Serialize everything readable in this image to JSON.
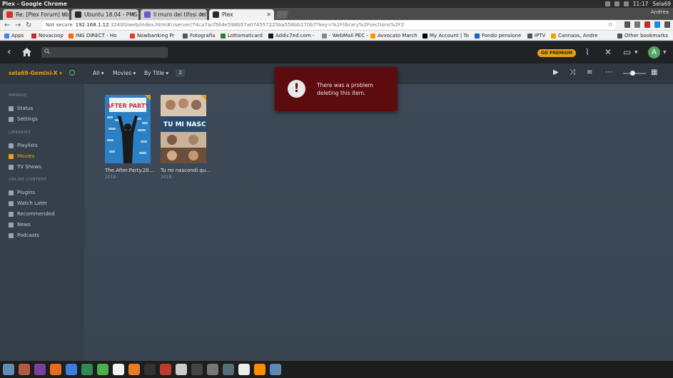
{
  "os": {
    "window_title": "Plex - Google Chrome",
    "time": "11:17",
    "user": "Sela69",
    "profile": "Andrea"
  },
  "tabs": [
    {
      "title": "Re: [Plex Forum] Ub",
      "color": "#d93025"
    },
    {
      "title": "Ubuntu 18.04 - PMS",
      "color": "#282828"
    },
    {
      "title": "Il muro dei tifosi del",
      "color": "#6a5acd"
    },
    {
      "title": "Plex",
      "color": "#282828"
    }
  ],
  "address": {
    "not_secure": "Not secure",
    "host": "192.168.1.12",
    "path": ":32400/web/index.html#!/server/74ca7acf564e598b57a074557225ba556bb170b7?key=%2Flibrary%2Fsections%2F2"
  },
  "bookmarks": [
    {
      "label": "Apps",
      "color": "#4285f4"
    },
    {
      "label": "Novacoop",
      "color": "#c62828"
    },
    {
      "label": "ING DIRECT - Ho",
      "color": "#ff6200"
    },
    {
      "label": "Nowbanking Pr",
      "color": "#e53935"
    },
    {
      "label": "Fotografia",
      "color": "#555555"
    },
    {
      "label": "Lottomaticard",
      "color": "#2e7d32"
    },
    {
      "label": "Addic7ed.com -",
      "color": "#1a1a1a"
    },
    {
      "label": "- WebMail PEC -",
      "color": "#888888"
    },
    {
      "label": "Avvocato March",
      "color": "#ff9800"
    },
    {
      "label": "My Account | To",
      "color": "#000000"
    },
    {
      "label": "Fondo pensione",
      "color": "#1565c0"
    },
    {
      "label": "IPTV",
      "color": "#555555"
    },
    {
      "label": "Cannaos, Andre",
      "color": "#e0a800"
    },
    {
      "label": "Other bookmarks",
      "color": "#555555"
    }
  ],
  "plex": {
    "go_premium": "GO PREMIUM",
    "avatar_letter": "A",
    "server": "sela69-Gemini-X",
    "filters": {
      "all": "All",
      "type": "Movies",
      "sort": "By Title",
      "count": "2"
    },
    "sidebar": {
      "manage_label": "MANAGE",
      "manage": [
        "Status",
        "Settings"
      ],
      "libraries_label": "LIBRARIES",
      "libraries": [
        "Playlists",
        "Movies",
        "TV Shows"
      ],
      "online_label": "ONLINE CONTENT",
      "online": [
        "Plugins",
        "Watch Later",
        "Recommended",
        "News",
        "Podcasts"
      ]
    },
    "items": [
      {
        "title": "The.After.Party.20...",
        "year": "2018",
        "poster_title": "AFTER PARTY"
      },
      {
        "title": "Tu mi nascondi qu...",
        "year": "2018",
        "poster_title": "TU MI NASCONDI"
      }
    ],
    "toast": {
      "message": "There was a problem deleting this item."
    },
    "accent": "#e5a00d",
    "error_bg": "#5c0b0f"
  },
  "dock_colors": [
    "#5e8db5",
    "#b35c44",
    "#7b3fa0",
    "#e86a1e",
    "#3b7ddd",
    "#2e8b57",
    "#4caf50",
    "#f2f2f2",
    "#e67e22",
    "#333333",
    "#c0392b",
    "#cccccc",
    "#444444",
    "#777777",
    "#546e7a",
    "#eeeeee",
    "#ff8c00",
    "#5d8ab4"
  ]
}
